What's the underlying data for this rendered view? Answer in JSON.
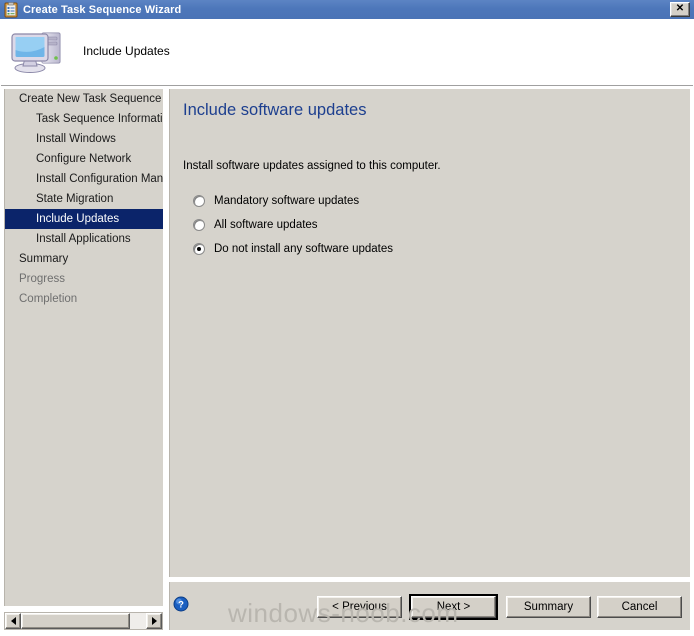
{
  "window": {
    "title": "Create Task Sequence Wizard",
    "titlebar_icon": "task-sequence-icon",
    "close_label": "✕",
    "titlebar_color": "#4d77ba"
  },
  "header": {
    "icon": "computer-icon",
    "title": "Include Updates"
  },
  "sidebar": {
    "items": [
      {
        "label": "Create New Task Sequence",
        "level": 0,
        "state": "normal"
      },
      {
        "label": "Task Sequence Information",
        "level": 1,
        "state": "normal"
      },
      {
        "label": "Install Windows",
        "level": 1,
        "state": "normal"
      },
      {
        "label": "Configure Network",
        "level": 1,
        "state": "normal"
      },
      {
        "label": "Install Configuration Manag",
        "level": 1,
        "state": "normal"
      },
      {
        "label": "State Migration",
        "level": 1,
        "state": "normal"
      },
      {
        "label": "Include Updates",
        "level": 1,
        "state": "selected"
      },
      {
        "label": "Install Applications",
        "level": 1,
        "state": "normal"
      },
      {
        "label": "Summary",
        "level": 0,
        "state": "normal"
      },
      {
        "label": "Progress",
        "level": 0,
        "state": "disabled"
      },
      {
        "label": "Completion",
        "level": 0,
        "state": "disabled"
      }
    ],
    "selected_color": "#0b246a"
  },
  "content": {
    "heading": "Include software updates",
    "heading_color": "#1d3f8f",
    "description": "Install software updates assigned to this computer.",
    "options": [
      {
        "label": "Mandatory software updates",
        "checked": false
      },
      {
        "label": "All software updates",
        "checked": false
      },
      {
        "label": "Do not install any software updates",
        "checked": true
      }
    ]
  },
  "footer": {
    "help_icon": "help-icon",
    "buttons": [
      {
        "label": "< Previous",
        "default": false
      },
      {
        "label": "Next >",
        "default": true
      },
      {
        "label": "Summary",
        "default": false
      },
      {
        "label": "Cancel",
        "default": false
      }
    ]
  },
  "watermark": {
    "text": "windows-noob.com"
  },
  "scrollbar": {
    "left_arrow": "scroll-left-icon",
    "right_arrow": "scroll-right-icon"
  }
}
